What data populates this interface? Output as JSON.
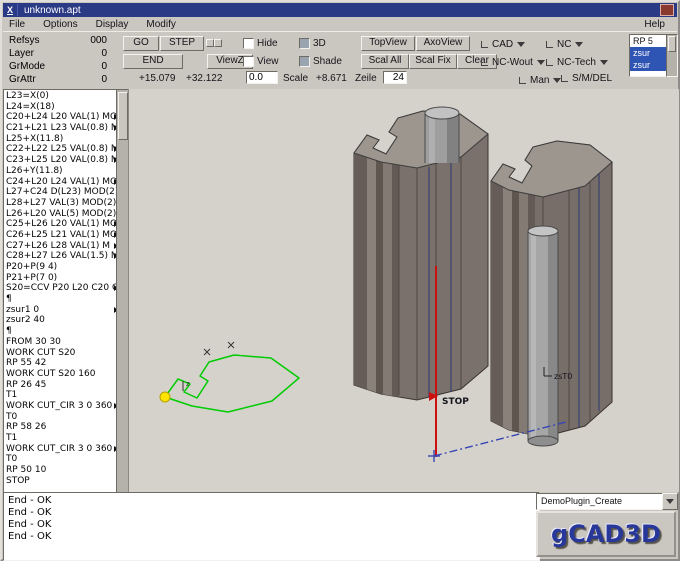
{
  "window": {
    "title": "unknown.apt",
    "menu_button": "X",
    "close_button": ""
  },
  "menubar": {
    "items": [
      "File",
      "Options",
      "Display",
      "Modify"
    ],
    "help": "Help"
  },
  "toolbar": {
    "status": [
      {
        "label": "Refsys",
        "value": "000"
      },
      {
        "label": "Layer",
        "value": "0"
      },
      {
        "label": "GrMode",
        "value": "0"
      },
      {
        "label": "GrAttr",
        "value": "0"
      }
    ],
    "go": "GO",
    "step": "STEP",
    "end": "END",
    "viewz": "ViewZ",
    "hide": "Hide",
    "threed": "3D",
    "view": "View",
    "shade": "Shade",
    "topview": "TopView",
    "axoview": "AxoView",
    "scal_all": "Scal All",
    "scal_fix": "Scal Fix",
    "clear": "Clear",
    "cad": "CAD",
    "nc": "NC",
    "nc_wout": "NC-Wout",
    "nc_tech": "NC-Tech",
    "man": "Man",
    "smdel": "S/M/DEL",
    "coord_x": "+15.079",
    "coord_y": "+32.122",
    "field_value": "0.0",
    "scale_label": "Scale",
    "scale_value": "+8.671",
    "zeile_label": "Zeile",
    "zeile_value": "24",
    "listbox": [
      {
        "label": "RP 5",
        "selected": false
      },
      {
        "label": "zsur",
        "selected": true
      },
      {
        "label": "zsur",
        "selected": true
      }
    ]
  },
  "code_panel": {
    "lines": [
      {
        "text": "L23=X(0)",
        "more": false
      },
      {
        "text": "L24=X(18)",
        "more": false
      },
      {
        "text": "C20+L24 L20 VAL(1) MO",
        "more": true
      },
      {
        "text": "C21+L21 L23 VAL(0.8) M",
        "more": true
      },
      {
        "text": "L25+X(11.8)",
        "more": false
      },
      {
        "text": "C22+L22 L25 VAL(0.8) M",
        "more": true
      },
      {
        "text": "C23+L25 L20 VAL(0.8) M",
        "more": true
      },
      {
        "text": "L26+Y(11.8)",
        "more": false
      },
      {
        "text": "C24+L20 L24 VAL(1) MO",
        "more": true
      },
      {
        "text": "L27+C24 D(L23) MOD(2)",
        "more": false
      },
      {
        "text": "L28+L27 VAL(3) MOD(2)",
        "more": false
      },
      {
        "text": "L26+L20 VAL(5) MOD(2)",
        "more": false
      },
      {
        "text": "C25+L26 L20 VAL(1) MO",
        "more": true
      },
      {
        "text": "C26+L25 L21 VAL(1) MO",
        "more": true
      },
      {
        "text": "C27+L26 L28 VAL(1) M",
        "more": true
      },
      {
        "text": "C28+L27 L26 VAL(1.5) M",
        "more": true
      },
      {
        "text": "P20+P(9 4)",
        "more": false
      },
      {
        "text": "P21+P(7 0)",
        "more": false
      },
      {
        "text": "S20=CCV P20 L20 C20 C",
        "more": true
      },
      {
        "text": "¶",
        "more": false
      },
      {
        "text": "zsur1 0",
        "more": true
      },
      {
        "text": "zsur2 40",
        "more": false
      },
      {
        "text": "¶",
        "more": false
      },
      {
        "text": "FROM 30 30",
        "more": false
      },
      {
        "text": "WORK CUT S20",
        "more": false
      },
      {
        "text": "RP 55 42",
        "more": false
      },
      {
        "text": "WORK CUT S20 160",
        "more": false
      },
      {
        "text": "RP 26 45",
        "more": false
      },
      {
        "text": "T1",
        "more": false
      },
      {
        "text": "WORK CUT_CIR 3 0 360 0",
        "more": true
      },
      {
        "text": "T0",
        "more": false
      },
      {
        "text": "RP 58 26",
        "more": false
      },
      {
        "text": "T1",
        "more": false
      },
      {
        "text": "WORK CUT_CIR 3 0 360 0",
        "more": true
      },
      {
        "text": "T0",
        "more": false
      },
      {
        "text": "RP 50 10",
        "more": false
      },
      {
        "text": "STOP",
        "more": false
      }
    ]
  },
  "viewport": {
    "stop": "STOP",
    "pin_label": "zsT0",
    "axis_z": "z"
  },
  "messages": [
    "End - OK",
    "End - OK",
    "End - OK",
    "End - OK"
  ],
  "plugin": {
    "selector": "DemoPlugin_Create",
    "logo": "gCAD3D"
  },
  "colors": {
    "titlebar": "#2a3a85",
    "selection": "#2f55b4",
    "block_face": "#7b716c",
    "profile_green": "#00cc00",
    "marker_red": "#cc1010",
    "guide_blue": "#3646b4",
    "point_yellow": "#ffe400",
    "logo_blue": "#27379a"
  }
}
